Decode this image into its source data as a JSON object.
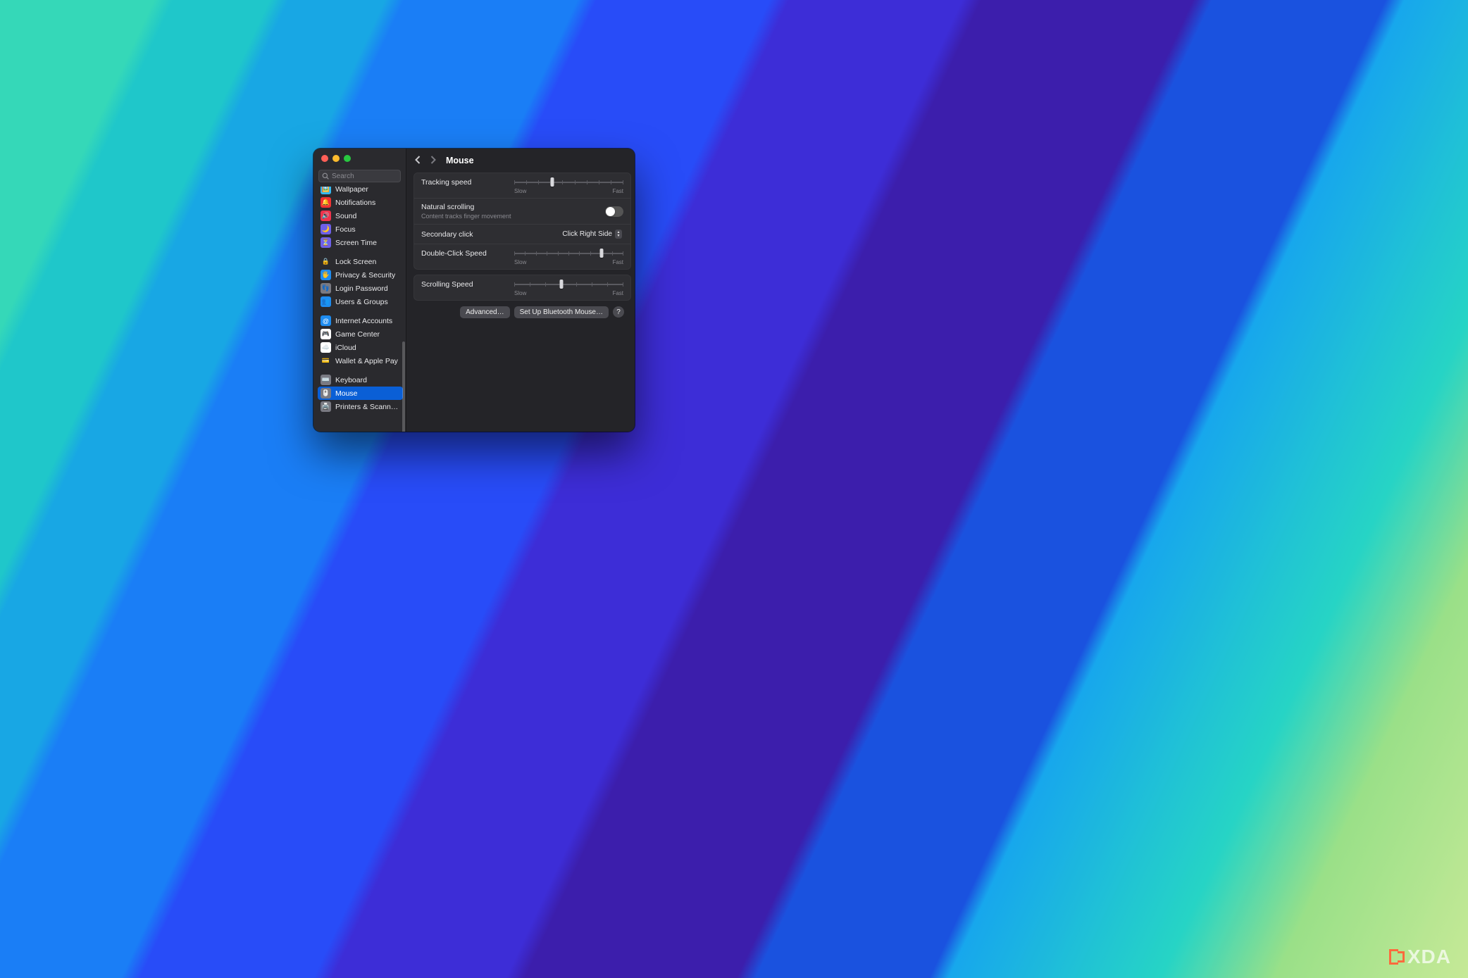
{
  "watermark": "XDA",
  "window": {
    "traffic": {
      "close": "close",
      "minimize": "minimize",
      "zoom": "zoom"
    }
  },
  "sidebar": {
    "search": {
      "placeholder": "Search"
    },
    "groups": [
      [
        {
          "label": "Wallpaper",
          "color": "#36b9f0"
        },
        {
          "label": "Notifications",
          "color": "#f03333"
        },
        {
          "label": "Sound",
          "color": "#f0334c"
        },
        {
          "label": "Focus",
          "color": "#6e60e8"
        },
        {
          "label": "Screen Time",
          "color": "#6e60e8"
        }
      ],
      [
        {
          "label": "Lock Screen",
          "color": "#2b2b2f"
        },
        {
          "label": "Privacy & Security",
          "color": "#1e8cf0"
        },
        {
          "label": "Login Password",
          "color": "#7a7a82"
        },
        {
          "label": "Users & Groups",
          "color": "#1e8cf0"
        }
      ],
      [
        {
          "label": "Internet Accounts",
          "color": "#1e8cf0"
        },
        {
          "label": "Game Center",
          "color": "#ffffff"
        },
        {
          "label": "iCloud",
          "color": "#ffffff"
        },
        {
          "label": "Wallet & Apple Pay",
          "color": "#2b2b2f"
        }
      ],
      [
        {
          "label": "Keyboard",
          "color": "#7a7a82"
        },
        {
          "label": "Mouse",
          "color": "#7a7a82",
          "selected": true
        },
        {
          "label": "Printers & Scanners",
          "color": "#7a7a82"
        }
      ]
    ]
  },
  "main": {
    "title": "Mouse",
    "tracking": {
      "label": "Tracking speed",
      "min_label": "Slow",
      "max_label": "Fast",
      "ticks": 10,
      "value_fraction": 0.35
    },
    "natural": {
      "label": "Natural scrolling",
      "sub": "Content tracks finger movement",
      "on": false
    },
    "secondary": {
      "label": "Secondary click",
      "value": "Click Right Side"
    },
    "doubleclick": {
      "label": "Double-Click Speed",
      "min_label": "Slow",
      "max_label": "Fast",
      "ticks": 11,
      "value_fraction": 0.8
    },
    "scrolling": {
      "label": "Scrolling Speed",
      "min_label": "Slow",
      "max_label": "Fast",
      "ticks": 8,
      "value_fraction": 0.43
    },
    "buttons": {
      "advanced": "Advanced…",
      "bluetooth": "Set Up Bluetooth Mouse…",
      "help": "?"
    }
  },
  "icons": {
    "wallpaper": "🖼️",
    "notifications": "🔔",
    "sound": "🔊",
    "focus": "🌙",
    "screen_time": "⏳",
    "lock_screen": "🔒",
    "privacy": "🖐️",
    "login_password": "👣",
    "users": "👥",
    "internet": "@",
    "game_center": "🎮",
    "icloud": "☁️",
    "wallet": "💳",
    "keyboard": "⌨️",
    "mouse": "🖱️",
    "printers": "🖨️"
  }
}
